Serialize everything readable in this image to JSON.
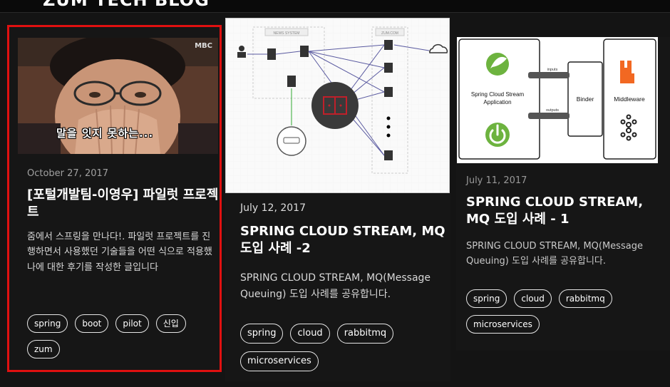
{
  "site": {
    "brand": "ZUM TECH BLOG"
  },
  "posts": [
    {
      "date": "October 27, 2017",
      "title": "[포털개발팀-이영우] 파일럿 프로젝트",
      "description": "줌에서 스프링을 만나다!. 파일럿 프로젝트를 진행하면서 사용했던 기술들을 어떤 식으로 적용했나에 대한 후기를 작성한 글입니다",
      "image_caption": "말을 잇지 못하는...",
      "image_logo": "MBC",
      "tags": [
        "spring",
        "boot",
        "pilot",
        "신입",
        "zum"
      ]
    },
    {
      "date": "July 12, 2017",
      "title": "SPRING CLOUD STREAM, MQ 도입 사례 -2",
      "description": "SPRING CLOUD STREAM, MQ(Message Queuing) 도입 사례를 공유합니다.",
      "diagram_labels": {
        "news": "NEWS SYSTEM",
        "zum": "ZUM.COM"
      },
      "tags": [
        "spring",
        "cloud",
        "rabbitmq",
        "microservices"
      ]
    },
    {
      "date": "July 11, 2017",
      "title": "SPRING CLOUD STREAM, MQ 도입 사례 - 1",
      "description": "SPRING CLOUD STREAM, MQ(Message Queuing) 도입 사례를 공유합니다.",
      "diagram": {
        "app": "Spring Cloud Stream Application",
        "inputs": "inputs",
        "outputs": "outputs",
        "binder": "Binder",
        "middleware": "Middleware"
      },
      "tags": [
        "spring",
        "cloud",
        "rabbitmq",
        "microservices"
      ]
    }
  ],
  "colors": {
    "highlight": "#e01010",
    "background": "#141414",
    "spring_green": "#6db33f",
    "rabbit_orange": "#f26822",
    "diagram_red": "#c0202a"
  }
}
